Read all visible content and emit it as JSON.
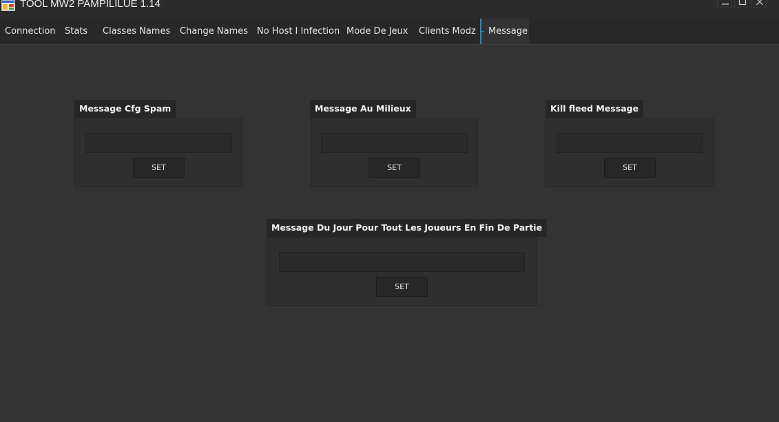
{
  "window": {
    "title": "TOOL MW2 PAMPILILUE 1.14"
  },
  "tabs": [
    {
      "label": "Connection"
    },
    {
      "label": "Stats"
    },
    {
      "label": "Classes Names"
    },
    {
      "label": "Change Names"
    },
    {
      "label": "No Host I Infection"
    },
    {
      "label": "Mode De Jeux"
    },
    {
      "label": "Clients Modz"
    },
    {
      "label": "Message",
      "active": true
    }
  ],
  "groups": [
    {
      "title": "Message Cfg Spam",
      "input_value": "",
      "button_label": "SET"
    },
    {
      "title": "Message Au Milieux",
      "input_value": "",
      "button_label": "SET"
    },
    {
      "title": "Kill fleed Message",
      "input_value": "",
      "button_label": "SET"
    },
    {
      "title": "Message Du Jour Pour Tout Les Joueurs En Fin De Partie",
      "input_value": "",
      "button_label": "SET"
    }
  ],
  "colors": {
    "background": "#333333",
    "tabstrip": "#282828",
    "accent": "#1e8fc6",
    "group_header": "#262626"
  }
}
